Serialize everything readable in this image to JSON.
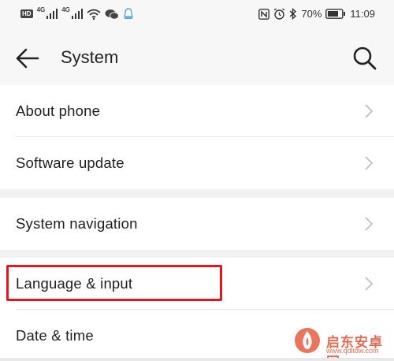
{
  "status_bar": {
    "left_icons": [
      "hd-icon",
      "signal-4g-icon",
      "signal-4g-icon",
      "wifi-icon",
      "wechat-icon",
      "notification-icon"
    ],
    "net_label_1": "4G",
    "net_label_2": "4G",
    "hd_label": "HD",
    "right_icons": [
      "nfc-icon",
      "alarm-icon",
      "bluetooth-icon",
      "battery-icon"
    ],
    "battery": "70%",
    "time": "11:09"
  },
  "header": {
    "title": "System"
  },
  "groups": [
    {
      "items": [
        {
          "label": "About phone"
        },
        {
          "label": "Software update"
        }
      ]
    },
    {
      "items": [
        {
          "label": "System navigation"
        }
      ]
    },
    {
      "items": [
        {
          "label": "Language & input"
        },
        {
          "label": "Date & time"
        }
      ]
    }
  ],
  "watermark": {
    "text": "启东安卓网",
    "url": "www.qdltdw.com"
  },
  "colors": {
    "highlight": "#e0171c",
    "background": "#f2f2f2",
    "watermark": "#e36b54"
  }
}
